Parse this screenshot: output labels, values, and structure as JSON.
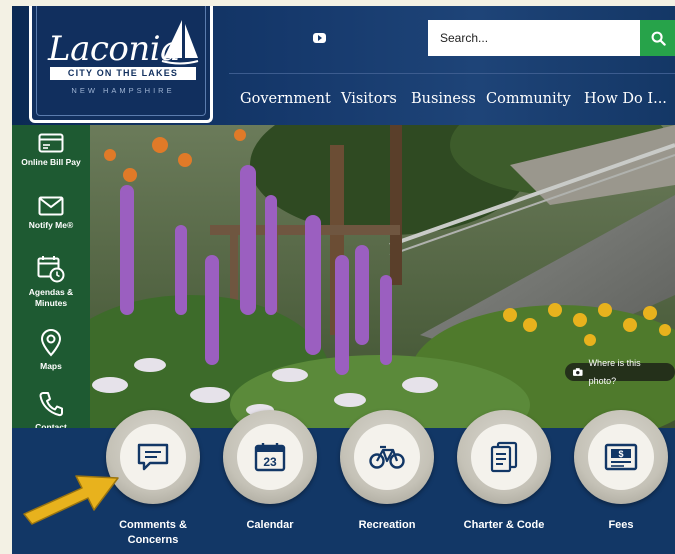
{
  "header": {
    "logo_script": "Laconia",
    "logo_tagline": "CITY ON THE LAKES",
    "logo_state": "NEW HAMPSHIRE",
    "search_placeholder": "Search...",
    "nav": [
      {
        "label": "Government"
      },
      {
        "label": "Visitors"
      },
      {
        "label": "Business"
      },
      {
        "label": "Community"
      },
      {
        "label": "How Do I..."
      }
    ]
  },
  "sidebar": {
    "items": [
      {
        "label": "Online Bill Pay",
        "icon": "bill-icon"
      },
      {
        "label": "Notify Me®",
        "icon": "envelope-icon"
      },
      {
        "label": "Agendas & Minutes",
        "icon": "calendar-clock-icon"
      },
      {
        "label": "Maps",
        "icon": "map-pin-icon"
      },
      {
        "label": "Contact",
        "icon": "phone-icon"
      }
    ]
  },
  "hero": {
    "photo_tag": "Where is this photo?"
  },
  "quick_links": [
    {
      "label": "Comments & Concerns",
      "icon": "speech-bubble-icon"
    },
    {
      "label": "Calendar",
      "icon": "calendar-icon",
      "icon_text": "23"
    },
    {
      "label": "Recreation",
      "icon": "bicycle-icon"
    },
    {
      "label": "Charter & Code",
      "icon": "document-icon"
    },
    {
      "label": "Fees",
      "icon": "bill-icon"
    }
  ],
  "colors": {
    "header_blue": "#15386b",
    "band_blue": "#123766",
    "sidebar_green": "#1e5a32",
    "search_green": "#27a34a",
    "arrow_gold": "#e8b21d"
  }
}
